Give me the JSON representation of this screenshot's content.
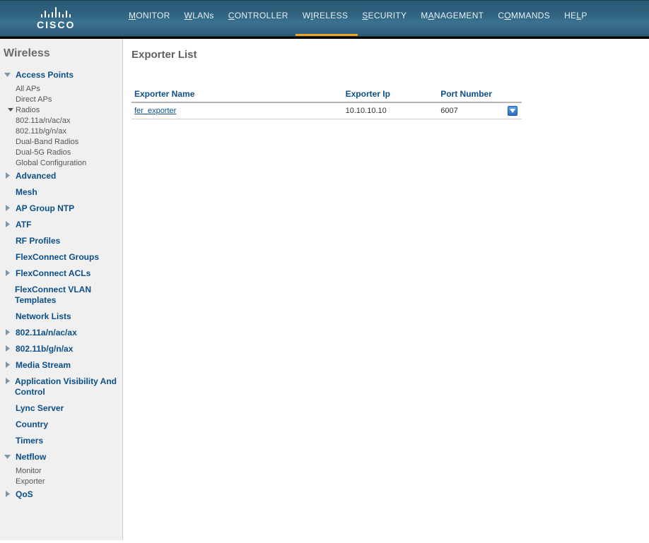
{
  "brand": "CISCO",
  "topnav": [
    {
      "first": "M",
      "rest": "ONITOR"
    },
    {
      "first": "W",
      "rest": "LANs"
    },
    {
      "first": "C",
      "rest": "ONTROLLER"
    },
    {
      "first": "W",
      "rest": "IRELESS",
      "accent_u": 1
    },
    {
      "first": "S",
      "rest": "ECURITY"
    },
    {
      "first": "M",
      "rest": "ANAGEMENT",
      "accent_a": 1
    },
    {
      "first": "C",
      "rest": "OMMANDS",
      "accent_o": 1
    },
    {
      "first": "H",
      "rest": "ELP",
      "accent_l": 2
    }
  ],
  "topnav_active_index": 3,
  "sidebar": {
    "title": "Wireless",
    "items": [
      {
        "label": "Access Points",
        "arrow": "down",
        "children": [
          {
            "label": "All APs"
          },
          {
            "label": "Direct APs"
          },
          {
            "label": "Radios",
            "sub": true,
            "children": [
              {
                "label": "802.11a/n/ac/ax"
              },
              {
                "label": "802.11b/g/n/ax"
              },
              {
                "label": "Dual-Band Radios"
              },
              {
                "label": "Dual-5G Radios"
              }
            ]
          },
          {
            "label": "Global Configuration"
          }
        ]
      },
      {
        "label": "Advanced",
        "arrow": "right"
      },
      {
        "label": "Mesh",
        "arrow": "none"
      },
      {
        "label": "AP Group NTP",
        "arrow": "right"
      },
      {
        "label": "ATF",
        "arrow": "right"
      },
      {
        "label": "RF Profiles",
        "arrow": "none"
      },
      {
        "label": "FlexConnect Groups",
        "arrow": "none"
      },
      {
        "label": "FlexConnect ACLs",
        "arrow": "right"
      },
      {
        "label": "FlexConnect VLAN Templates",
        "arrow": "none"
      },
      {
        "label": "Network Lists",
        "arrow": "none"
      },
      {
        "label": "802.11a/n/ac/ax",
        "arrow": "right"
      },
      {
        "label": "802.11b/g/n/ax",
        "arrow": "right"
      },
      {
        "label": "Media Stream",
        "arrow": "right"
      },
      {
        "label": "Application Visibility And Control",
        "arrow": "right"
      },
      {
        "label": "Lync Server",
        "arrow": "none"
      },
      {
        "label": "Country",
        "arrow": "none"
      },
      {
        "label": "Timers",
        "arrow": "none"
      },
      {
        "label": "Netflow",
        "arrow": "down",
        "children": [
          {
            "label": "Monitor"
          },
          {
            "label": "Exporter"
          }
        ]
      },
      {
        "label": "QoS",
        "arrow": "right"
      }
    ]
  },
  "main": {
    "title": "Exporter List",
    "columns": [
      "Exporter Name",
      "Exporter Ip",
      "Port Number"
    ],
    "rows": [
      {
        "name": "fer_exporter",
        "ip": "10.10.10.10",
        "port": "6007"
      }
    ]
  }
}
